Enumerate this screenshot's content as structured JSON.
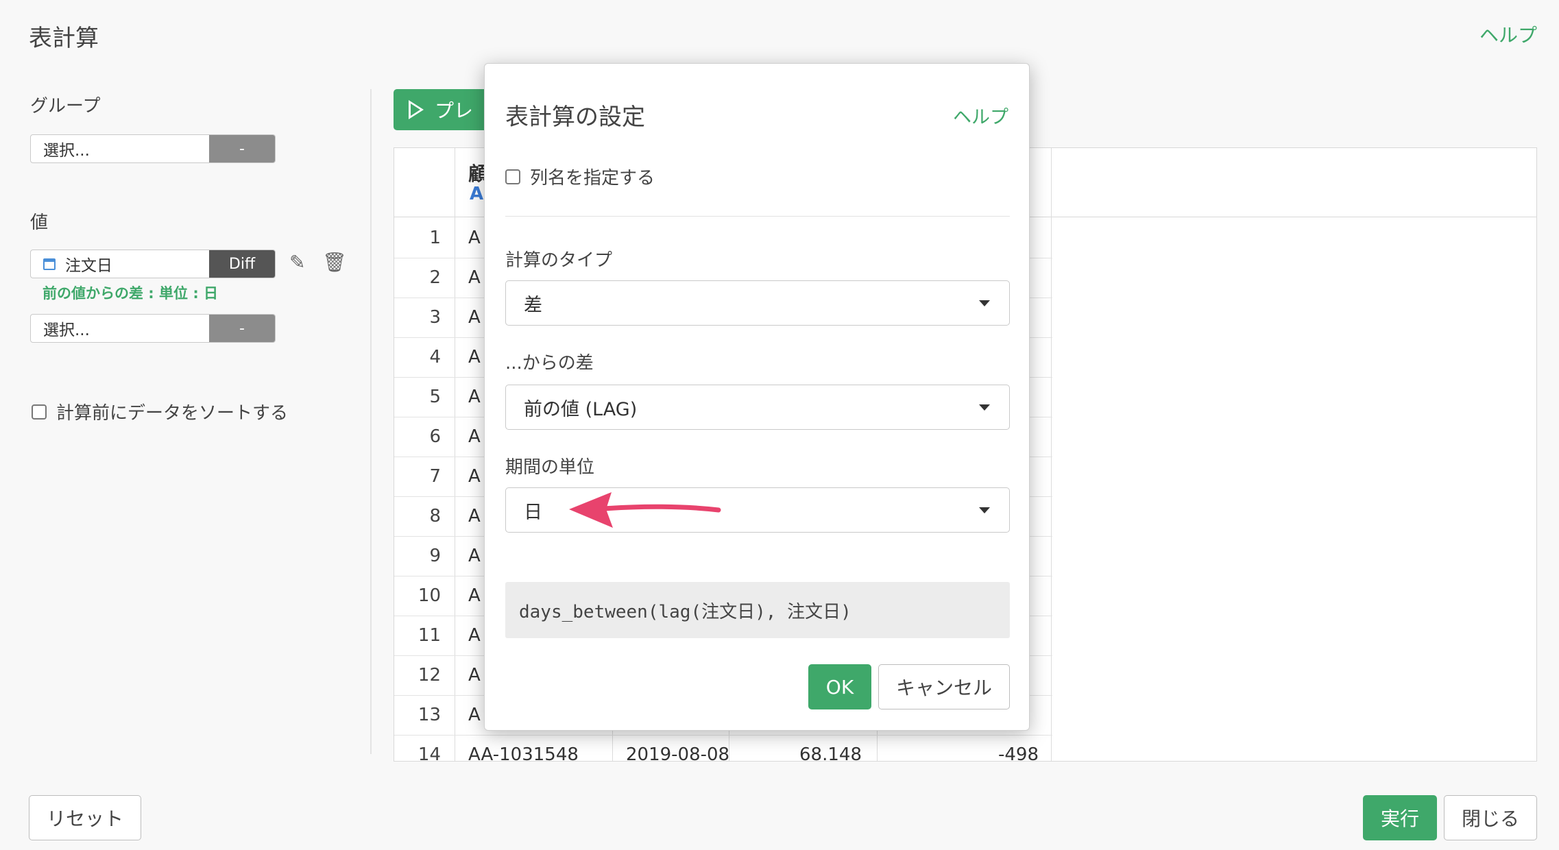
{
  "page": {
    "title": "表計算",
    "help": "ヘルプ"
  },
  "left_panel": {
    "group_label": "グループ",
    "group_select_placeholder": "選択...",
    "group_select_button": "-",
    "value_label": "値",
    "value_field": "注文日",
    "value_field_button": "Diff",
    "value_note": "前の値からの差 : 単位 : 日",
    "value_select2_placeholder": "選択...",
    "value_select2_button": "-",
    "sort_checkbox_label": "計算前にデータをソートする"
  },
  "preview_button_label": "プレ",
  "table": {
    "header_snippet1": "顧",
    "header_snippet2": "A",
    "rows": [
      {
        "num": "1",
        "c1": "A",
        "c2": "",
        "c3": "",
        "c4": ""
      },
      {
        "num": "2",
        "c1": "A",
        "c2": "",
        "c3": "",
        "c4": ""
      },
      {
        "num": "3",
        "c1": "A",
        "c2": "",
        "c3": "",
        "c4": ""
      },
      {
        "num": "4",
        "c1": "A",
        "c2": "",
        "c3": "",
        "c4": ""
      },
      {
        "num": "5",
        "c1": "A",
        "c2": "",
        "c3": "",
        "c4": ""
      },
      {
        "num": "6",
        "c1": "A",
        "c2": "",
        "c3": "",
        "c4": ""
      },
      {
        "num": "7",
        "c1": "A",
        "c2": "",
        "c3": "",
        "c4": ""
      },
      {
        "num": "8",
        "c1": "A",
        "c2": "",
        "c3": "",
        "c4": ""
      },
      {
        "num": "9",
        "c1": "A",
        "c2": "",
        "c3": "",
        "c4": ""
      },
      {
        "num": "10",
        "c1": "A",
        "c2": "",
        "c3": "",
        "c4": ""
      },
      {
        "num": "11",
        "c1": "A",
        "c2": "",
        "c3": "",
        "c4": ""
      },
      {
        "num": "12",
        "c1": "A",
        "c2": "",
        "c3": "",
        "c4": ""
      },
      {
        "num": "13",
        "c1": "A",
        "c2": "",
        "c3": "",
        "c4": ""
      },
      {
        "num": "14",
        "c1": "AA-1031548",
        "c2": "2019-08-08",
        "c3": "68.148",
        "c4": "-498"
      }
    ]
  },
  "bottom": {
    "reset": "リセット",
    "run": "実行",
    "close": "閉じる"
  },
  "modal": {
    "title": "表計算の設定",
    "help": "ヘルプ",
    "column_name_checkbox": "列名を指定する",
    "calc_type_label": "計算のタイプ",
    "calc_type_value": "差",
    "diff_from_label": "...からの差",
    "diff_from_value": "前の値 (LAG)",
    "period_unit_label": "期間の単位",
    "period_unit_value": "日",
    "formula": "days_between(lag(注文日), 注文日)",
    "ok": "OK",
    "cancel": "キャンセル"
  },
  "colors": {
    "accent_green": "#3fa86a",
    "arrow_pink": "#e8436d",
    "date_blue": "#4a8fd8"
  }
}
